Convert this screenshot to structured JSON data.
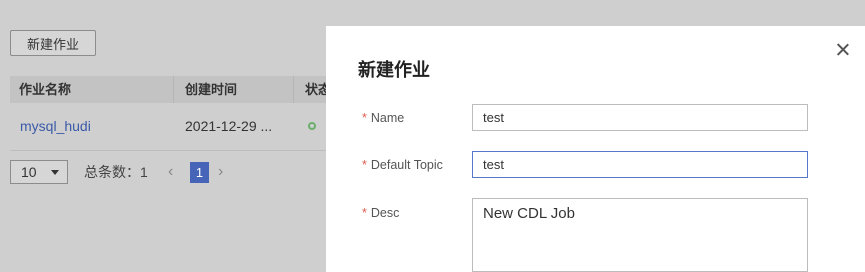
{
  "background": {
    "new_job_button": "新建作业",
    "columns": [
      "作业名称",
      "创建时间",
      "状态"
    ],
    "row": {
      "name": "mysql_hudi",
      "created": "2021-12-29 ..."
    },
    "pager": {
      "page_size": "10",
      "total": "总条数：1",
      "prev": "‹",
      "current_page": "1",
      "next": "›"
    }
  },
  "drawer": {
    "title": "新建作业",
    "fields": [
      {
        "required_mark": "*",
        "label": "Name",
        "value": "test"
      },
      {
        "required_mark": "*",
        "label": "Default Topic",
        "value": "test"
      },
      {
        "required_mark": "*",
        "label": "Desc",
        "value": "New CDL Job"
      }
    ]
  }
}
